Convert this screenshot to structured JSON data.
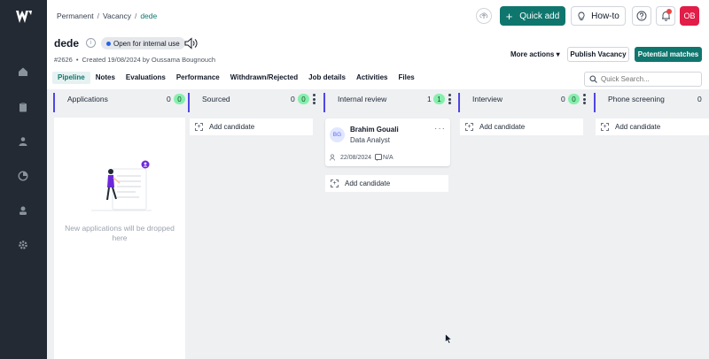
{
  "sidebar": {
    "logo": "workflow-logo",
    "items": [
      {
        "name": "home",
        "icon": "home-icon"
      },
      {
        "name": "clipboard",
        "icon": "clipboard-icon"
      },
      {
        "name": "people",
        "icon": "people-icon"
      },
      {
        "name": "analytics",
        "icon": "pie-chart-icon"
      },
      {
        "name": "user",
        "icon": "user-icon"
      },
      {
        "name": "settings",
        "icon": "gear-icon"
      }
    ]
  },
  "breadcrumb": {
    "items": [
      "Permanent",
      "Vacancy",
      "dede"
    ],
    "separator": "/"
  },
  "topbar": {
    "upload_icon": "cloud-upload-icon",
    "quick_add": "Quick add",
    "how_to": "How-to",
    "help_icon": "question-icon",
    "bell_icon": "bell-icon",
    "avatar_initials": "OB"
  },
  "vacancy": {
    "title": "dede",
    "status_badge": "Open for internal use",
    "id": "#2626",
    "created": "Created 19/08/2024 by Oussama Bougnouch"
  },
  "actions": {
    "more_actions": "More actions",
    "publish": "Publish Vacancy",
    "potential": "Potential matches"
  },
  "tabs": [
    {
      "label": "Pipeline",
      "active": true
    },
    {
      "label": "Notes"
    },
    {
      "label": "Evaluations"
    },
    {
      "label": "Performance"
    },
    {
      "label": "Withdrawn/Rejected"
    },
    {
      "label": "Job details"
    },
    {
      "label": "Activities"
    },
    {
      "label": "Files"
    }
  ],
  "search": {
    "placeholder": "Quick Search..."
  },
  "columns": [
    {
      "name": "Applications",
      "count": "0",
      "pill": "0"
    },
    {
      "name": "Sourced",
      "count": "0",
      "pill": "0"
    },
    {
      "name": "Internal review",
      "count": "1",
      "pill": "1"
    },
    {
      "name": "Interview",
      "count": "0",
      "pill": "0"
    },
    {
      "name": "Phone screening",
      "count": "0",
      "pill": "0"
    }
  ],
  "empty_applications": "New applications will be dropped here",
  "add_candidate": "Add candidate",
  "candidate": {
    "initials": "BG",
    "name": "Brahim Gouali",
    "role": "Data Analyst",
    "date": "22/08/2024",
    "score": "N/A"
  },
  "colors": {
    "sidebar": "#232a33",
    "primary": "#0f766e",
    "avatar": "#e11d48",
    "column_accent": "#4f46e5",
    "pill": "#86efac"
  }
}
